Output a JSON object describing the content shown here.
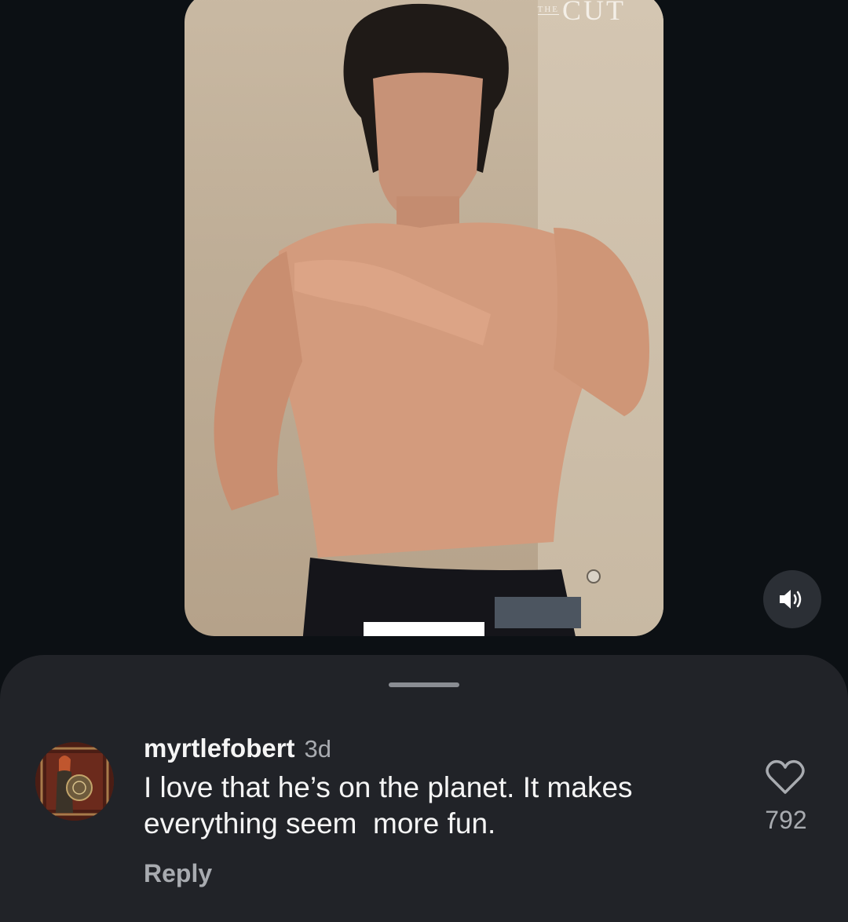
{
  "video": {
    "brand_small": "THE",
    "brand_large": "CUT",
    "mute_icon": "speaker-volume-icon"
  },
  "comments_sheet": {
    "comment": {
      "username": "myrtlefobert",
      "time": "3d",
      "text": "I love that he’s on the planet. It makes\neverything seem  more fun.",
      "reply_label": "Reply",
      "like_count": "792",
      "like_icon": "heart-outline-icon"
    }
  }
}
